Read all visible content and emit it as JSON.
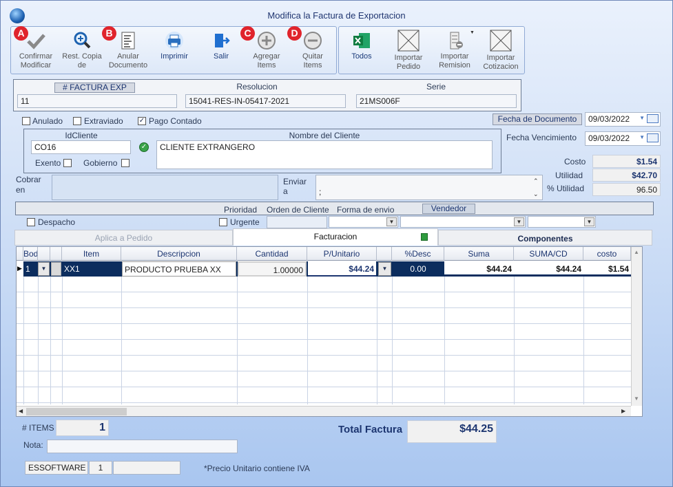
{
  "window": {
    "title": "Modifica la Factura de Exportacion"
  },
  "toolbar": {
    "confirmar": "Confirmar\nModificar",
    "rest_copia": "Rest. Copia\nde",
    "anular": "Anular\nDocumento",
    "imprimir": "Imprimir",
    "salir": "Salir",
    "agregar": "Agregar\nItems",
    "quitar": "Quitar\nItems",
    "todos": "Todos",
    "importar_pedido": "Importar\nPedido",
    "importar_remision": "Importar\nRemision",
    "importar_cotizacion": "Importar\nCotizacion",
    "badges": {
      "a": "A",
      "b": "B",
      "c": "C",
      "d": "D"
    }
  },
  "header": {
    "factura_label": "# FACTURA EXP",
    "factura_value": "11",
    "resolucion_label": "Resolucion",
    "resolucion_value": "15041-RES-IN-05417-2021",
    "serie_label": "Serie",
    "serie_value": "21MS006F"
  },
  "flags": {
    "anulado": "Anulado",
    "extraviado": "Extraviado",
    "pago_contado": "Pago Contado",
    "pago_contado_checked": "✓"
  },
  "dates": {
    "fecha_doc_label": "Fecha de  Documento",
    "fecha_doc": "09/03/2022",
    "fecha_venc_label": "Fecha Vencimiento",
    "fecha_venc": "09/03/2022"
  },
  "cliente": {
    "id_label": "IdCliente",
    "id_value": "CO16",
    "nombre_label": "Nombre del Cliente",
    "nombre_value": "CLIENTE EXTRANGERO",
    "exento": "Exento",
    "gobierno": "Gobierno"
  },
  "totales_side": {
    "costo_label": "Costo",
    "costo": "$1.54",
    "utilidad_label": "Utilidad",
    "utilidad": "$42.70",
    "pct_label": "% Utilidad",
    "pct": "96.50"
  },
  "cobrar": {
    "label1": "Cobrar",
    "label2": "en",
    "value": ""
  },
  "enviar": {
    "label1": "Enviar",
    "label2": "a",
    "value": ";"
  },
  "envio": {
    "prioridad": "Prioridad",
    "orden_cliente": "Orden de Cliente",
    "forma_envio": "Forma de envio",
    "vendedor": "Vendedor",
    "despacho": "Despacho",
    "urgente": "Urgente"
  },
  "tabs": {
    "aplica": "Aplica a Pedido",
    "facturacion": "Facturacion",
    "componentes": "Componentes"
  },
  "grid": {
    "columns": [
      "Bodega",
      "",
      "Item",
      "Descripcion",
      "Cantidad",
      "P/Unitario",
      "",
      "%Desc",
      "Suma",
      "SUMA/CD",
      "costo"
    ],
    "rows": [
      {
        "bodega": "1",
        "item": "XX1",
        "descripcion": "PRODUCTO PRUEBA XX",
        "cantidad": "1.00000",
        "punitario": "$44.24",
        "desc": "0.00",
        "suma": "$44.24",
        "sumacd": "$44.24",
        "costo": "$1.54"
      }
    ]
  },
  "footer": {
    "items_label": "# ITEMS",
    "items": "1",
    "total_label": "Total Factura",
    "total": "$44.25",
    "nota_label": "Nota:",
    "nota": "",
    "user": "ESSOFTWARE",
    "num": "1",
    "precio_note": "*Precio Unitario contiene IVA"
  },
  "colors": {
    "accent": "#1c3b7a",
    "badge": "#e0242c",
    "selected_row": "#0c2d5e"
  }
}
